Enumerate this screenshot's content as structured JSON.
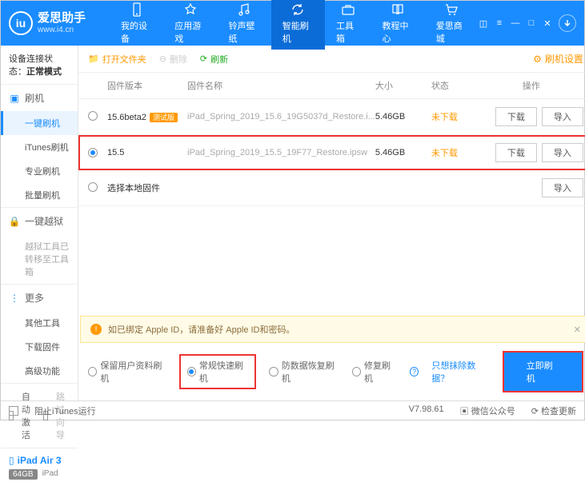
{
  "brand": {
    "name": "爱思助手",
    "url": "www.i4.cn"
  },
  "nav": [
    {
      "label": "我的设备"
    },
    {
      "label": "应用游戏"
    },
    {
      "label": "铃声壁纸"
    },
    {
      "label": "智能刷机"
    },
    {
      "label": "工具箱"
    },
    {
      "label": "教程中心"
    },
    {
      "label": "爱思商城"
    }
  ],
  "sidebar": {
    "status_label": "设备连接状态：",
    "status_value": "正常模式",
    "flash": {
      "title": "刷机",
      "items": [
        "一键刷机",
        "iTunes刷机",
        "专业刷机",
        "批量刷机"
      ]
    },
    "jailbreak": {
      "title": "一键越狱",
      "note": "越狱工具已转移至工具箱"
    },
    "more": {
      "title": "更多",
      "items": [
        "其他工具",
        "下载固件",
        "高级功能"
      ]
    },
    "auto_activate": "自动激活",
    "skip_guide": "跳过向导",
    "device": {
      "name": "iPad Air 3",
      "storage": "64GB",
      "type": "iPad"
    }
  },
  "toolbar": {
    "open": "打开文件夹",
    "delete": "删除",
    "refresh": "刷新",
    "settings": "刷机设置"
  },
  "columns": {
    "version": "固件版本",
    "name": "固件名称",
    "size": "大小",
    "status": "状态",
    "ops": "操作"
  },
  "rows": [
    {
      "ver": "15.6beta2",
      "beta": "测试版",
      "name": "iPad_Spring_2019_15.6_19G5037d_Restore.i...",
      "size": "5.46GB",
      "status": "未下载"
    },
    {
      "ver": "15.5",
      "name": "iPad_Spring_2019_15.5_19F77_Restore.ipsw",
      "size": "5.46GB",
      "status": "未下载"
    }
  ],
  "local_fw": "选择本地固件",
  "btns": {
    "download": "下载",
    "import": "导入"
  },
  "notice": "如已绑定 Apple ID，请准备好 Apple ID和密码。",
  "options": {
    "keep": "保留用户资料刷机",
    "normal": "常规快速刷机",
    "antirec": "防数据恢复刷机",
    "repair": "修复刷机",
    "exclude": "只想抹除数据？",
    "flash_now": "立即刷机"
  },
  "statusbar": {
    "block": "阻止iTunes运行",
    "version": "V7.98.61",
    "wechat": "微信公众号",
    "update": "检查更新"
  }
}
